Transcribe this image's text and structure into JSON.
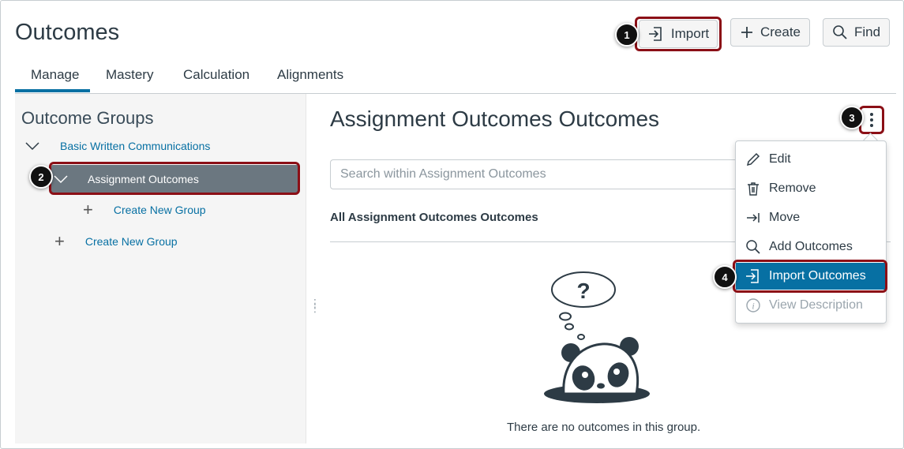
{
  "header": {
    "title": "Outcomes",
    "import_label": "Import",
    "create_label": "Create",
    "find_label": "Find"
  },
  "tabs": [
    {
      "label": "Manage",
      "active": true
    },
    {
      "label": "Mastery"
    },
    {
      "label": "Calculation"
    },
    {
      "label": "Alignments"
    }
  ],
  "sidebar": {
    "title": "Outcome Groups",
    "items": [
      {
        "label": "Basic Written Communications"
      },
      {
        "label": "Assignment Outcomes",
        "selected": true
      },
      {
        "label": "Create New Group"
      },
      {
        "label": "Create New Group"
      }
    ]
  },
  "main": {
    "title": "Assignment Outcomes Outcomes",
    "search_placeholder": "Search within Assignment Outcomes",
    "subheading": "All Assignment Outcomes Outcomes",
    "empty_message": "There are no outcomes in this group."
  },
  "menu": {
    "items": [
      {
        "label": "Edit",
        "icon": "pencil-icon"
      },
      {
        "label": "Remove",
        "icon": "trash-icon"
      },
      {
        "label": "Move",
        "icon": "move-icon"
      },
      {
        "label": "Add Outcomes",
        "icon": "search-icon"
      },
      {
        "label": "Import Outcomes",
        "icon": "import-icon",
        "active": true
      },
      {
        "label": "View Description",
        "icon": "info-icon",
        "disabled": true
      }
    ]
  },
  "callouts": [
    "1",
    "2",
    "3",
    "4"
  ],
  "colors": {
    "accent": "#0770a3",
    "highlight": "#8b0f16",
    "selected_row": "#6b7780"
  }
}
